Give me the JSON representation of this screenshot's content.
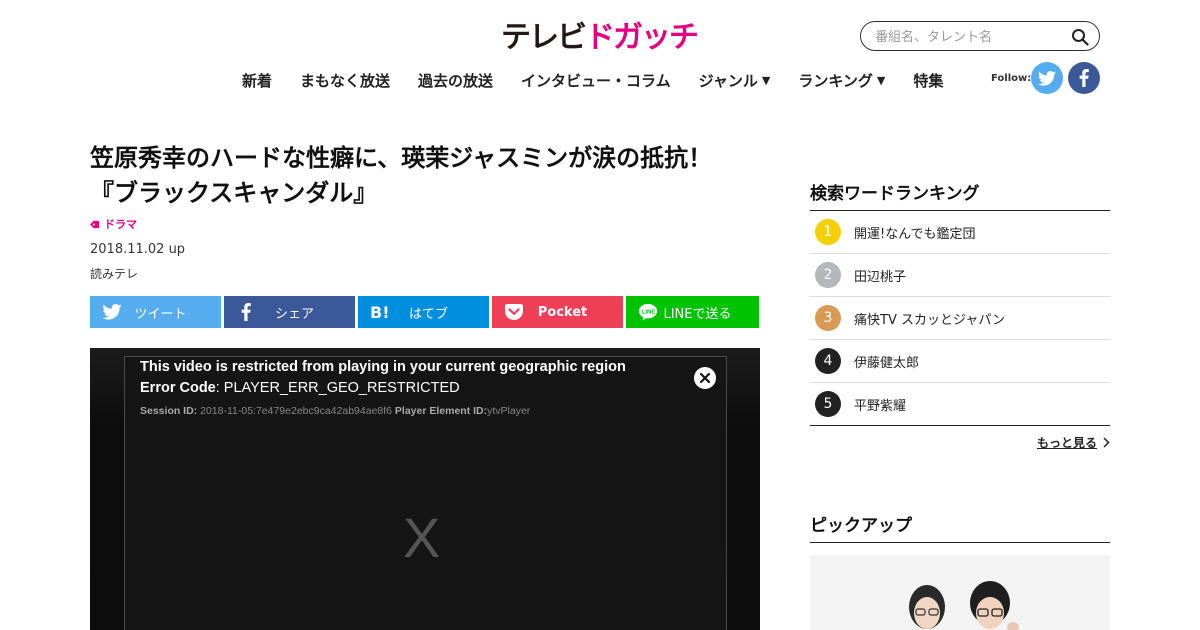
{
  "header": {
    "logo_part1": "テレビ",
    "logo_part2": "ドガッチ",
    "search_placeholder": "番組名、タレント名",
    "nav": [
      {
        "label": "新着",
        "caret": false
      },
      {
        "label": "まもなく放送",
        "caret": false
      },
      {
        "label": "過去の放送",
        "caret": false
      },
      {
        "label": "インタビュー・コラム",
        "caret": false
      },
      {
        "label": "ジャンル",
        "caret": true
      },
      {
        "label": "ランキング",
        "caret": true
      },
      {
        "label": "特集",
        "caret": false
      }
    ],
    "follow_label": "Follow:",
    "colors": {
      "brand_pink": "#e4007f",
      "twitter": "#55acee",
      "facebook": "#3b5998"
    }
  },
  "article": {
    "title": "笠原秀幸のハードな性癖に、瑛茉ジャスミンが涙の抵抗！『ブラックスキャンダル』",
    "category": "ドラマ",
    "date": "2018.11.02 up",
    "station": "読みテレ",
    "share": [
      {
        "label": "ツイート",
        "icon": "twitter-icon",
        "color": "#55acee"
      },
      {
        "label": "シェア",
        "icon": "facebook-icon",
        "color": "#3b5998"
      },
      {
        "label": "はてブ",
        "icon": "hatena-icon",
        "color": "#008fde"
      },
      {
        "label": "Pocket",
        "icon": "pocket-icon",
        "color": "#ef3f56"
      },
      {
        "label": "LINEで送る",
        "icon": "line-icon",
        "color": "#00c300"
      }
    ]
  },
  "video_error": {
    "message": "This video is restricted from playing in your current geographic region",
    "code_label": "Error Code",
    "code_value": ": PLAYER_ERR_GEO_RESTRICTED",
    "session_label": "Session ID:",
    "session_value": " 2018-11-05:7e479e2ebc9ca42ab94ae8f6 ",
    "element_label": "Player Element ID:",
    "element_value": "ytvPlayer",
    "placeholder_x": "X"
  },
  "sidebar": {
    "ranking_title": "検索ワードランキング",
    "ranking": [
      {
        "rank": "1",
        "label": "開運!なんでも鑑定団",
        "color": "#f5d000"
      },
      {
        "rank": "2",
        "label": "田辺桃子",
        "color": "#b4b8bc"
      },
      {
        "rank": "3",
        "label": "痛快TV スカッとジャパン",
        "color": "#d99a55"
      },
      {
        "rank": "4",
        "label": "伊藤健太郎",
        "color": "#222222"
      },
      {
        "rank": "5",
        "label": "平野紫耀",
        "color": "#222222"
      }
    ],
    "more_label": "もっと見る",
    "pickup_title": "ピックアップ"
  }
}
